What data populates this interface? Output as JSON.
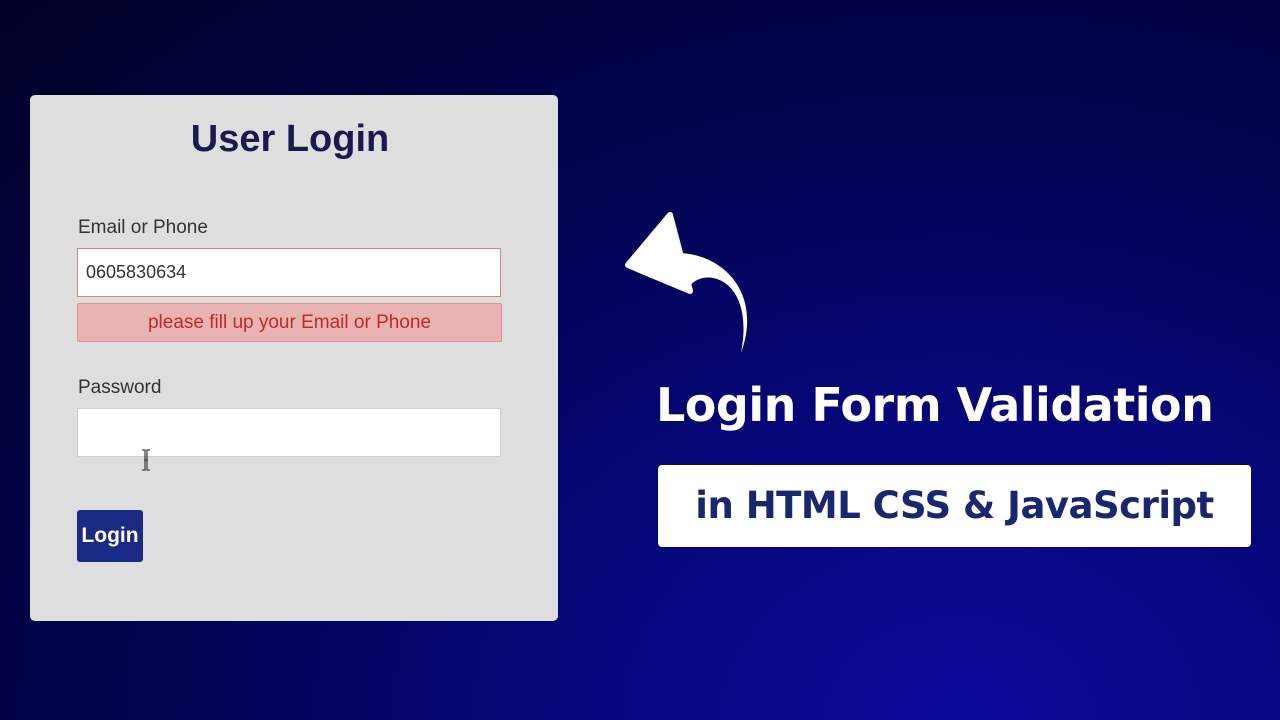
{
  "login_form": {
    "title": "User Login",
    "email_label": "Email or Phone",
    "email_value": "0605830634",
    "error_message": "please fill up your Email or Phone",
    "password_label": "Password",
    "password_value": "",
    "login_button_label": "Login"
  },
  "banner": {
    "headline": "Login Form Validation",
    "subheadline": "in HTML CSS & JavaScript"
  },
  "icons": {
    "arrow": "curved-arrow-icon",
    "cursor": "text-cursor-icon"
  },
  "colors": {
    "card_background": "#dedede",
    "title_text": "#1a1a4e",
    "error_background": "#e9b3b3",
    "error_text": "#c22a2a",
    "login_button": "#1a2a85",
    "subheadline_text": "#1a2670",
    "page_background": "#03034f"
  }
}
